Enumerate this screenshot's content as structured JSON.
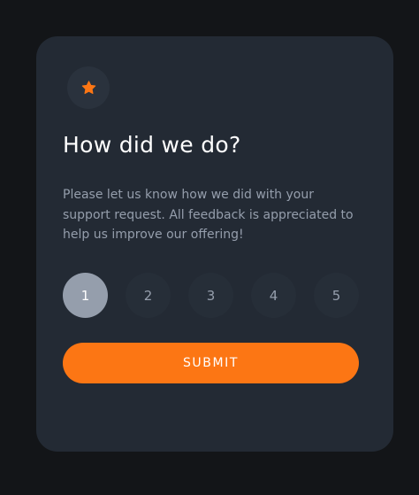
{
  "colors": {
    "background": "#131518",
    "card": "#232a34",
    "accent": "#fc7614",
    "selected": "#959eac",
    "muted_text": "#959eac"
  },
  "card": {
    "icon": "star-icon",
    "title": "How did we do?",
    "description": "Please let us know how we did with your support request. All feedback is appreciated to help us improve our offering!",
    "ratings": [
      {
        "label": "1",
        "selected": true
      },
      {
        "label": "2",
        "selected": false
      },
      {
        "label": "3",
        "selected": false
      },
      {
        "label": "4",
        "selected": false
      },
      {
        "label": "5",
        "selected": false
      }
    ],
    "submit_label": "SUBMIT"
  }
}
